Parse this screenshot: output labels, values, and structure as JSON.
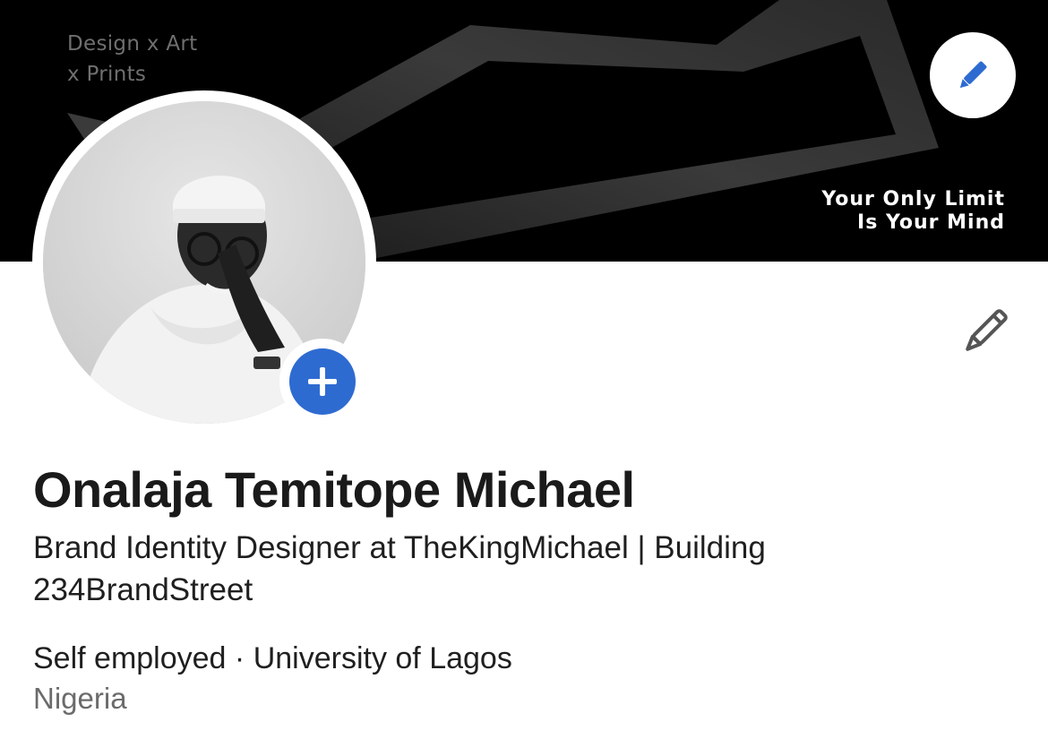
{
  "banner": {
    "tagline_line1": "Design x Art",
    "tagline_line2": "x Prints",
    "motto_line1": "Your Only Limit",
    "motto_line2": "Is Your Mind",
    "edit_icon": "pencil-icon"
  },
  "avatar": {
    "add_icon": "plus-icon"
  },
  "profile": {
    "edit_icon": "pencil-icon",
    "name": "Onalaja Temitope Michael",
    "headline": "Brand Identity Designer at TheKingMichael | Building 234BrandStreet",
    "employment": "Self employed",
    "separator": "·",
    "education": "University of Lagos",
    "location": "Nigeria"
  },
  "colors": {
    "accent": "#2e6bd1",
    "banner_bg": "#000000",
    "text_primary": "#1a1a1a",
    "text_secondary": "#6b6b6b"
  }
}
